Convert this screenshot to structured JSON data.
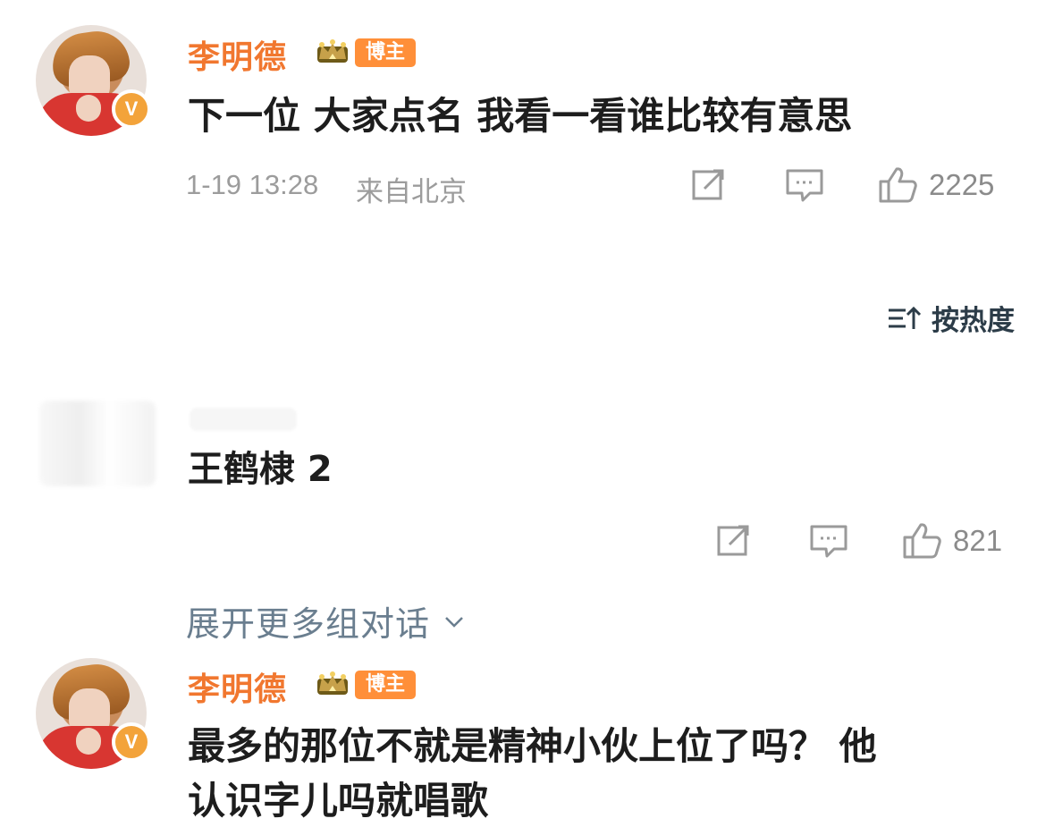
{
  "comments": [
    {
      "username": "李明德",
      "tag": "博主",
      "text": "下一位 大家点名 我看一看谁比较有意思",
      "time": "1-19 13:28",
      "location": "来自北京",
      "likes": "2225"
    },
    {
      "username": "",
      "text": "王鹤棣 2",
      "likes": "821"
    },
    {
      "username": "李明德",
      "tag": "博主",
      "text_line1": "最多的那位不就是精神小伙上位了吗？ 他",
      "text_line2": "认识字儿吗就唱歌"
    }
  ],
  "sort": {
    "label": "按热度"
  },
  "expand": {
    "label": "展开更多组对话"
  },
  "icons": {
    "share": "share-icon",
    "comment": "comment-icon",
    "like": "like-icon",
    "sort": "sort-icon",
    "expand": "chevron-down-icon",
    "verified": "verified-icon",
    "crown": "crown-icon"
  },
  "colors": {
    "username": "#f1772f",
    "tag_bg": "#ff8f39",
    "meta": "#9c9c9c",
    "sort": "#2c3c48",
    "expand": "#6a7e8f"
  }
}
